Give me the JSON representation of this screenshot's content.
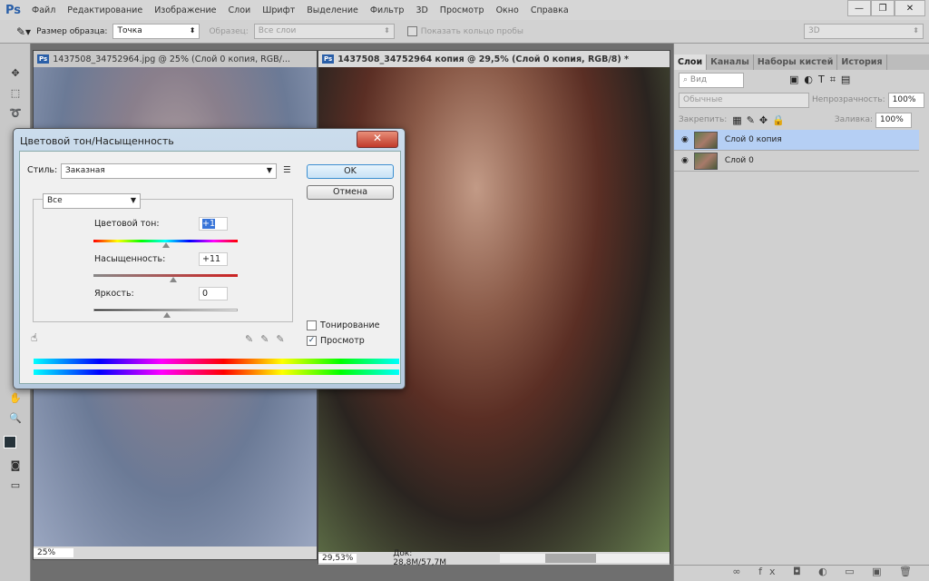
{
  "app": {
    "logo": "Ps"
  },
  "menu": [
    "Файл",
    "Редактирование",
    "Изображение",
    "Слои",
    "Шрифт",
    "Выделение",
    "Фильтр",
    "3D",
    "Просмотр",
    "Окно",
    "Справка"
  ],
  "options": {
    "sample_size_label": "Размер образца:",
    "sample_size_value": "Точка",
    "sample_label": "Образец:",
    "sample_value": "Все слои",
    "show_ring_label": "Показать кольцо пробы",
    "mode_3d": "3D"
  },
  "documents": [
    {
      "title": "1437508_34752964.jpg @ 25% (Слой 0 копия, RGB/...",
      "zoom": "25%"
    },
    {
      "title": "1437508_34752964 копия @ 29,5% (Слой 0 копия, RGB/8) *",
      "zoom": "29,53%",
      "doc_size": "Док: 28,8M/57,7M"
    }
  ],
  "panel": {
    "tabs": [
      "Слои",
      "Каналы",
      "Наборы кистей",
      "История"
    ],
    "filter": "Вид",
    "blend": "Обычные",
    "opacity_label": "Непрозрачность:",
    "opacity": "100%",
    "lock_label": "Закрепить:",
    "fill_label": "Заливка:",
    "fill": "100%",
    "layers": [
      {
        "name": "Слой 0 копия",
        "selected": true
      },
      {
        "name": "Слой 0",
        "selected": false
      }
    ]
  },
  "dialog": {
    "title": "Цветовой тон/Насыщенность",
    "style_label": "Стиль:",
    "style_value": "Заказная",
    "ok": "OK",
    "cancel": "Отмена",
    "channel": "Все",
    "hue_label": "Цветовой тон:",
    "hue": "+1",
    "saturation_label": "Насыщенность:",
    "saturation": "+11",
    "lightness_label": "Яркость:",
    "lightness": "0",
    "colorize_label": "Тонирование",
    "colorize": false,
    "preview_label": "Просмотр",
    "preview": true
  }
}
